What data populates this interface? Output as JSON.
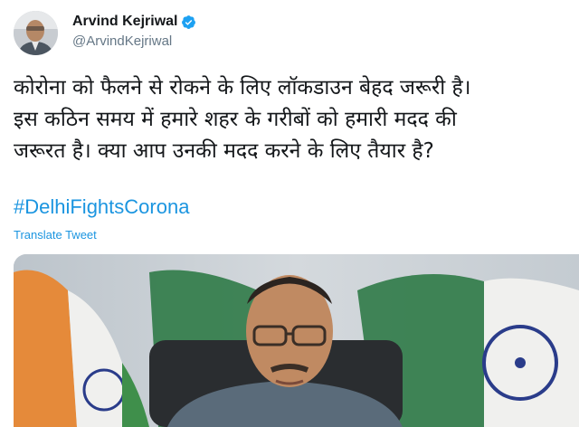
{
  "tweet": {
    "author_name": "Arvind Kejriwal",
    "author_handle": "@ArvindKejriwal",
    "text_lines": [
      "कोरोना को फैलने से रोकने के लिए लॉकडाउन बेहद जरूरी है।",
      "इस कठिन समय में हमारे शहर के गरीबों को हमारी मदद की",
      "जरूरत है। क्या आप उनकी मदद करने के लिए तैयार है?"
    ],
    "hashtag": "#DelhiFightsCorona",
    "translate_label": "Translate Tweet"
  },
  "icons": {
    "verified": "verified-badge-icon",
    "avatar": "avatar-photo"
  },
  "colors": {
    "link": "#1b95e0",
    "verified": "#1da1f2",
    "text": "#14171a",
    "muted": "#657786"
  }
}
